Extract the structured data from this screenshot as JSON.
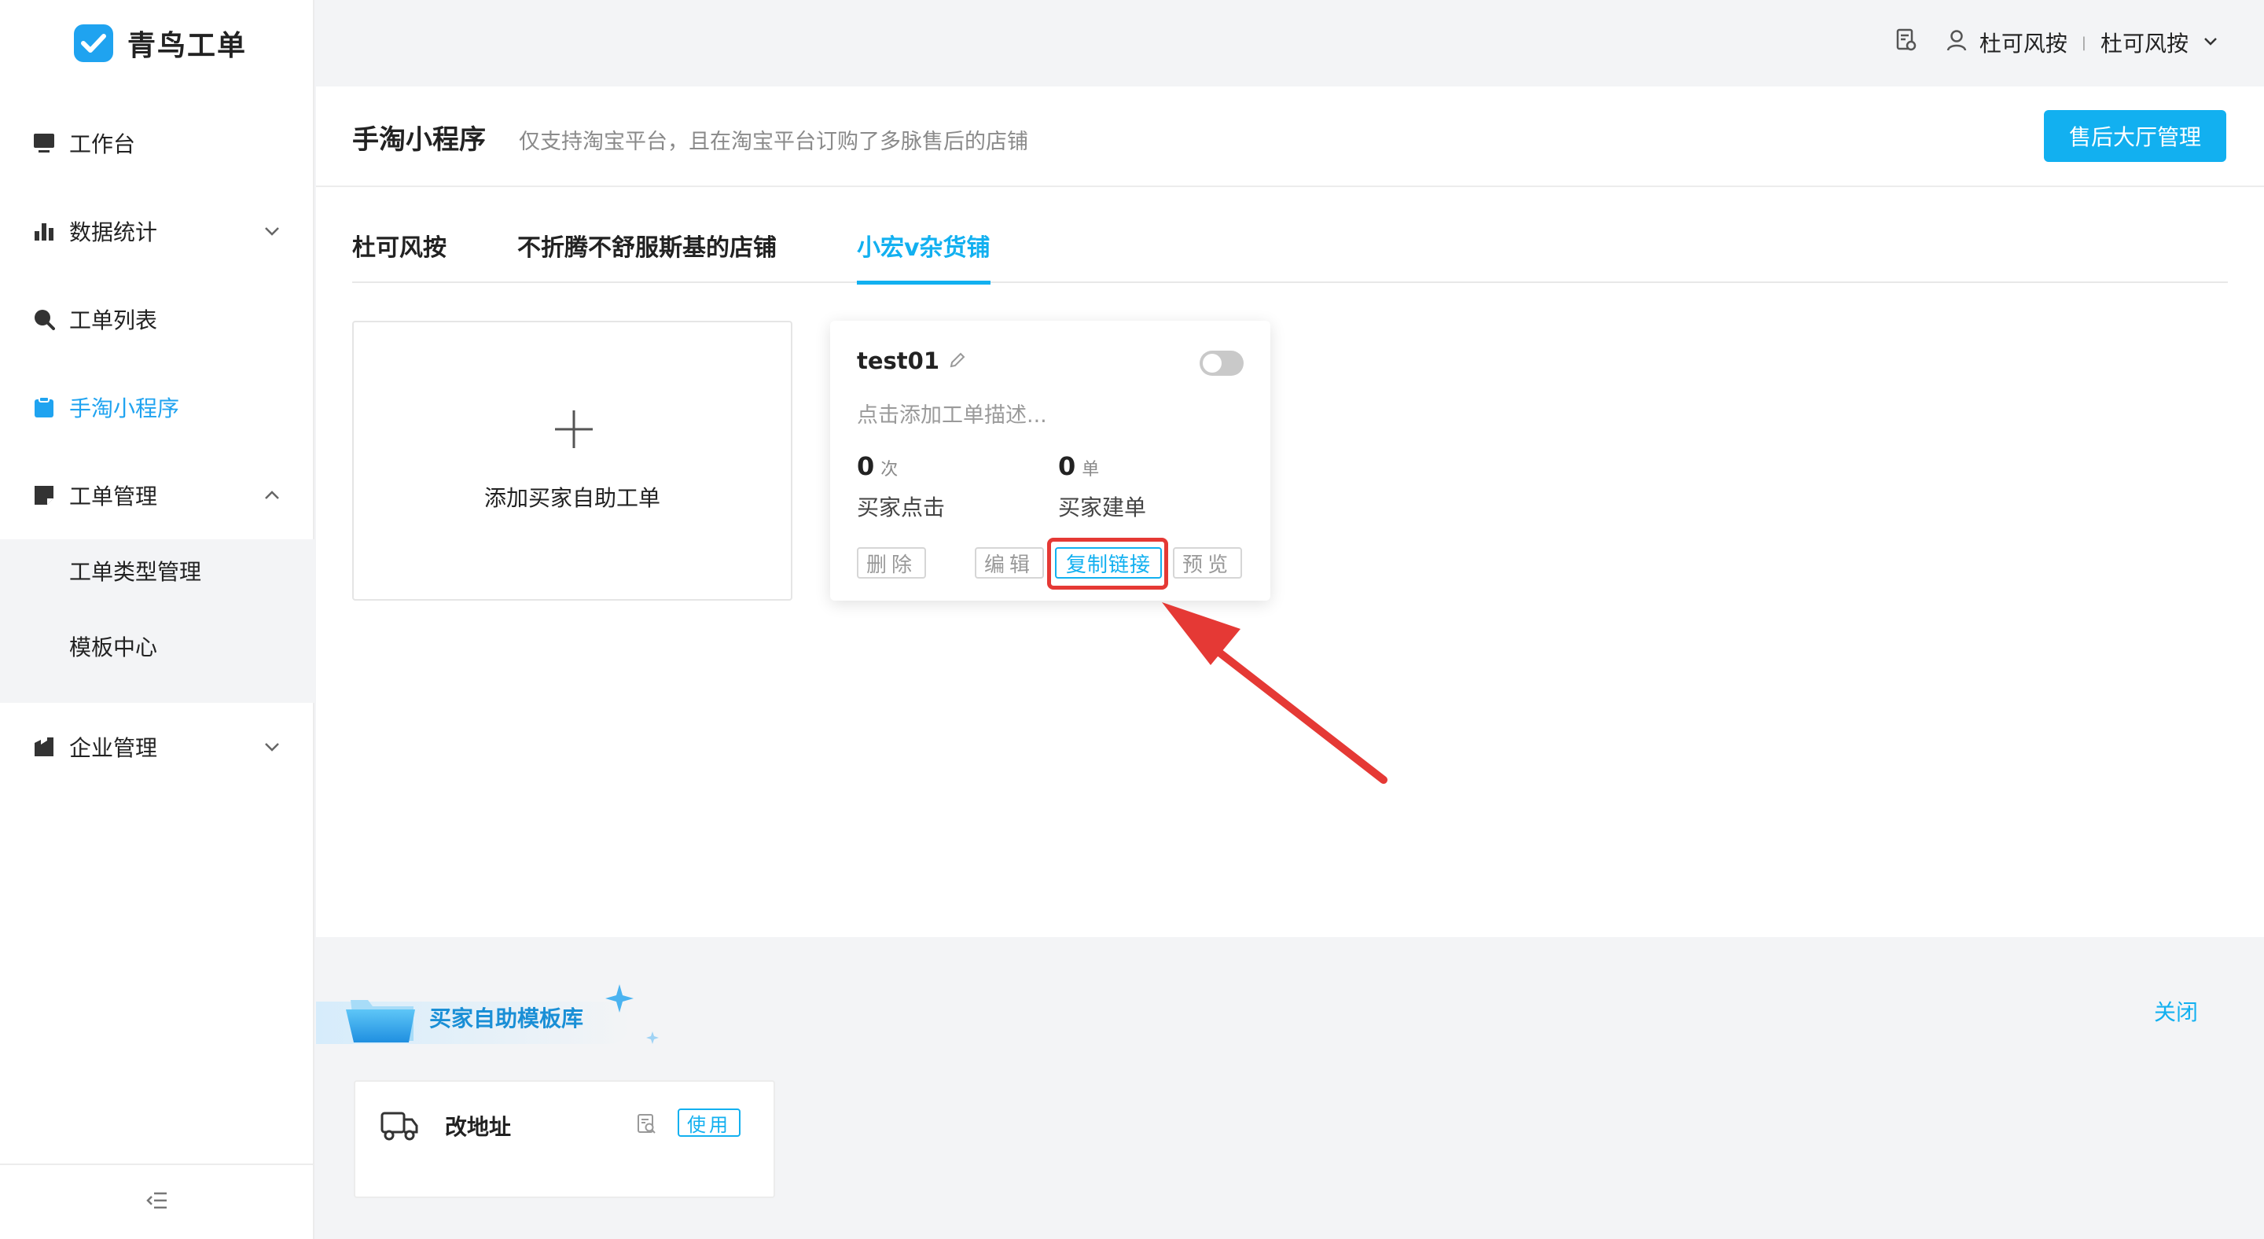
{
  "app": {
    "name": "青鸟工单"
  },
  "user": {
    "name": "杜可风按",
    "org": "杜可风按"
  },
  "sidebar": {
    "items": [
      {
        "label": "工作台"
      },
      {
        "label": "数据统计"
      },
      {
        "label": "工单列表"
      },
      {
        "label": "手淘小程序",
        "active": true
      },
      {
        "label": "工单管理"
      },
      {
        "label": "企业管理"
      }
    ],
    "subitems": [
      {
        "label": "工单类型管理"
      },
      {
        "label": "模板中心"
      }
    ]
  },
  "page": {
    "title": "手淘小程序",
    "description": "仅支持淘宝平台，且在淘宝平台订购了多脉售后的店铺",
    "primary_button": "售后大厅管理"
  },
  "tabs": [
    {
      "label": "杜可风按"
    },
    {
      "label": "不折腾不舒服斯基的店铺"
    },
    {
      "label": "小宏v杂货铺",
      "active": true
    }
  ],
  "add_card": {
    "label": "添加买家自助工单"
  },
  "workorder_card": {
    "title": "test01",
    "enabled": false,
    "description_placeholder": "点击添加工单描述...",
    "stats": [
      {
        "value": "0",
        "unit": "次",
        "label": "买家点击"
      },
      {
        "value": "0",
        "unit": "单",
        "label": "买家建单"
      }
    ],
    "actions": {
      "delete": "删除",
      "edit": "编辑",
      "copy_link": "复制链接",
      "preview": "预览"
    }
  },
  "template_library": {
    "title": "买家自助模板库",
    "close_label": "关闭",
    "templates": [
      {
        "name": "改地址",
        "use_label": "使用"
      }
    ]
  },
  "colors": {
    "accent": "#12b0f0",
    "annotation": "#e53935"
  }
}
